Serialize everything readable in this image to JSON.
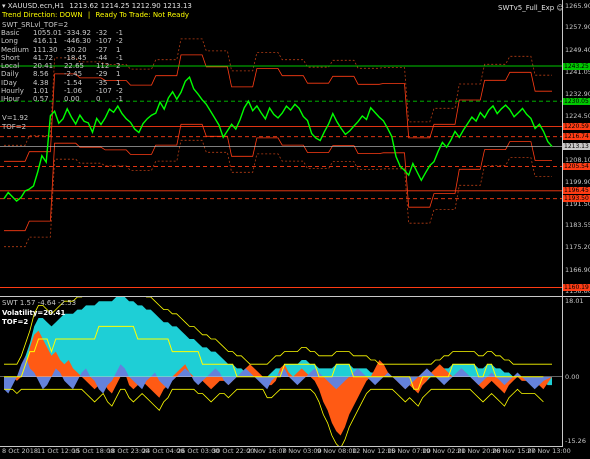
{
  "header": {
    "symbol": "XAUUSD.ecn,H1",
    "ohlc": "1213.62 1214.25 1212.90 1213.13",
    "trend_label": "Trend Direction:",
    "trend_value": "DOWN",
    "sep1": "|",
    "ready": "Ready To Trade:",
    "ready_value": "Not Ready",
    "expert": "SWTv5_Full_Exp",
    "expert_icon": "smiley-icon"
  },
  "panel": {
    "title": "SWT_SRLvl_TOF=2",
    "rows": [
      {
        "name": "Basic",
        "a": "1055.01",
        "b": "-334.92",
        "c": "-32",
        "d": "-1"
      },
      {
        "name": "Long",
        "a": "416.11",
        "b": "-446.30",
        "c": "-107",
        "d": "-2"
      },
      {
        "name": "Medium",
        "a": "111.30",
        "b": "-30.20",
        "c": "-27",
        "d": "1"
      },
      {
        "name": "Short",
        "a": "41.72",
        "b": "-18.45",
        "c": "-44",
        "d": "-1"
      },
      {
        "name": "Local",
        "a": "20.41",
        "b": "22.65",
        "c": "112",
        "d": "2"
      },
      {
        "name": "Daily",
        "a": "8.56",
        "b": "-2.45",
        "c": "-29",
        "d": "1"
      },
      {
        "name": "IDay",
        "a": "4.38",
        "b": "-1.54",
        "c": "-35",
        "d": "1"
      },
      {
        "name": "Hourly",
        "a": "1.01",
        "b": "-1.06",
        "c": "-107",
        "d": "-2"
      },
      {
        "name": "IHour",
        "a": "0.57",
        "b": "0.00",
        "c": "0",
        "d": "-1"
      }
    ],
    "v_line": "V=1.92",
    "tof_line": "TOF=2"
  },
  "sub": {
    "title": "SWT 1.57 -4.64 -2.53",
    "volatility": "Volatility=20.41",
    "tof": "TOF=2"
  },
  "colors": {
    "price": "#00ff00",
    "green_level": "#00c800",
    "red_level": "#ff3c14",
    "cyan": "#1ecfd6",
    "orange": "#ff5a14",
    "blue": "#6482dc",
    "yellow": "#ffff00"
  },
  "chart_data": [
    {
      "type": "line",
      "title": "",
      "y_ticks": [
        "1265.90",
        "1257.90",
        "1249.40",
        "1241.05",
        "1232.90",
        "1224.50",
        "1216.15",
        "1208.10",
        "1199.90",
        "1191.50",
        "1183.55",
        "1175.20",
        "1166.90",
        "1158.80"
      ],
      "ylim": [
        1157.0,
        1268.0
      ],
      "price": [
        1193.5,
        1195.8,
        1194.2,
        1192.6,
        1193.9,
        1196.4,
        1197.1,
        1198.3,
        1203.5,
        1209.6,
        1207.2,
        1224.6,
        1226.3,
        1221.8,
        1223.4,
        1227.2,
        1224.1,
        1221.5,
        1224.8,
        1222.5,
        1221.9,
        1218.4,
        1223.6,
        1221.3,
        1223.8,
        1227.1,
        1225.9,
        1228.2,
        1225.4,
        1223.5,
        1222.1,
        1219.6,
        1218.3,
        1221.7,
        1223.5,
        1224.8,
        1225.6,
        1229.7,
        1227.1,
        1231.3,
        1233.6,
        1230.8,
        1233.4,
        1237.5,
        1239.1,
        1234.7,
        1232.8,
        1230.6,
        1228.9,
        1226.3,
        1223.7,
        1221.1,
        1216.5,
        1218.9,
        1221.4,
        1219.6,
        1223.2,
        1227.6,
        1230.1,
        1226.5,
        1228.3,
        1225.7,
        1223.4,
        1227.5,
        1225.1,
        1223.8,
        1225.6,
        1228.2,
        1226.7,
        1228.9,
        1227.4,
        1224.3,
        1222.8,
        1217.9,
        1216.2,
        1215.3,
        1218.6,
        1221.5,
        1225.4,
        1222.3,
        1219.8,
        1217.6,
        1218.9,
        1220.7,
        1222.4,
        1224.5,
        1223.2,
        1227.6,
        1225.8,
        1224.1,
        1222.7,
        1219.9,
        1216.8,
        1209.3,
        1205.6,
        1204.1,
        1202.3,
        1206.7,
        1203.5,
        1200.4,
        1203.2,
        1205.9,
        1207.4,
        1211.3,
        1214.6,
        1212.8,
        1215.4,
        1218.7,
        1216.5,
        1219.3,
        1221.7,
        1224.1,
        1222.6,
        1225.8,
        1223.9,
        1226.7,
        1228.3,
        1225.4,
        1227.2,
        1228.6,
        1226.9,
        1224.2,
        1225.7,
        1227.3,
        1225.1,
        1223.6,
        1219.8,
        1221.4,
        1218.7,
        1214.9,
        1213.1
      ],
      "levels": [
        {
          "value": "1243.25",
          "color": "#00c800"
        },
        {
          "value": "1230.05",
          "color": "#00c800"
        },
        {
          "value": "1220.59",
          "color": "#ff3c14"
        },
        {
          "value": "1216.74",
          "color": "#ff3c14"
        },
        {
          "value": "1213.13",
          "color": "#c8c8c8"
        },
        {
          "value": "1205.54",
          "color": "#ff3c14"
        },
        {
          "value": "1196.45",
          "color": "#ff3c14"
        },
        {
          "value": "1193.50",
          "color": "#ff3c14"
        },
        {
          "value": "1160.19",
          "color": "#ff3c14"
        }
      ]
    },
    {
      "type": "area",
      "title": "",
      "y_ticks": [
        "18.01",
        "0.00",
        "-15.26"
      ],
      "ylim": [
        -16.5,
        19.0
      ],
      "cyan": [
        0,
        0,
        0,
        0,
        2,
        5,
        8,
        12,
        14,
        14,
        13,
        12,
        13,
        14,
        15,
        15,
        15,
        16,
        16,
        17,
        17,
        17,
        18,
        18,
        18,
        18,
        19,
        19,
        19,
        18,
        18,
        17,
        17,
        16,
        16,
        15,
        14,
        13,
        13,
        12,
        12,
        11,
        10,
        9,
        9,
        8,
        7,
        7,
        6,
        6,
        5,
        4,
        3,
        3,
        2,
        2,
        1,
        0,
        0,
        0,
        0,
        0,
        1,
        2,
        2,
        3,
        3,
        3,
        3,
        4,
        4,
        3,
        3,
        2,
        2,
        2,
        2,
        3,
        3,
        3,
        3,
        2,
        2,
        2,
        2,
        1,
        1,
        0,
        0,
        0,
        0,
        0,
        0,
        -1,
        -2,
        -3,
        -3,
        -2,
        -1,
        0,
        1,
        1,
        2,
        2,
        3,
        3,
        3,
        3,
        3,
        3,
        2,
        2,
        3,
        3,
        2,
        2,
        1,
        1,
        0,
        0,
        0,
        0,
        0,
        0,
        -1,
        -1,
        -2,
        -2
      ],
      "orange": [
        0,
        0,
        0,
        -1,
        0,
        2,
        7,
        10,
        11,
        9,
        7,
        5,
        6,
        4,
        3,
        4,
        2,
        1,
        0,
        -1,
        -2,
        -3,
        -2,
        -1,
        -3,
        -4,
        -2,
        0,
        1,
        -2,
        -3,
        -2,
        -1,
        -2,
        -3,
        -4,
        -5,
        -3,
        -2,
        0,
        1,
        2,
        3,
        1,
        0,
        -1,
        -1,
        -2,
        -3,
        -2,
        -1,
        -1,
        -2,
        -1,
        0,
        1,
        2,
        3,
        2,
        1,
        0,
        -2,
        -2,
        -1,
        2,
        3,
        1,
        0,
        1,
        2,
        1,
        0,
        -1,
        -3,
        -6,
        -8,
        -11,
        -13,
        -14,
        -12,
        -9,
        -7,
        -5,
        -3,
        -1,
        0,
        2,
        4,
        3,
        1,
        0,
        -1,
        -2,
        -3,
        -2,
        -3,
        -4,
        -2,
        -1,
        1,
        2,
        3,
        2,
        1,
        0,
        1,
        2,
        1,
        0,
        -1,
        -2,
        -3,
        -2,
        -1,
        -2,
        -3,
        -4,
        -2,
        -1,
        0,
        -1,
        -1,
        -1,
        -1,
        -2,
        -3
      ],
      "blue": [
        -3,
        -4,
        -2,
        0,
        3,
        5,
        2,
        1,
        -1,
        -3,
        -2,
        0,
        2,
        1,
        -1,
        -2,
        -3,
        -1,
        1,
        2,
        0,
        -1,
        -3,
        -4,
        -2,
        -1,
        1,
        3,
        2,
        0,
        -1,
        -2,
        -3,
        -1,
        0,
        1,
        -1,
        -2,
        -3,
        -1,
        0,
        1,
        2,
        1,
        -1,
        -2,
        -1,
        0,
        1,
        2,
        1,
        -1,
        -2,
        -1,
        0,
        1,
        2,
        1,
        0,
        -1,
        -2,
        -3,
        -1,
        0,
        1,
        2,
        0,
        -1,
        -2,
        -1,
        0,
        1,
        2,
        1,
        0,
        -1,
        -2,
        -3,
        -2,
        -1,
        0,
        1,
        2,
        1,
        0,
        -1,
        -2,
        -1,
        0,
        1,
        0,
        -1,
        -2,
        -3,
        -2,
        -1,
        0,
        1,
        2,
        1,
        0,
        -1,
        -2,
        -1,
        0,
        1,
        2,
        1,
        0,
        -1,
        -2,
        -1,
        0,
        1,
        0,
        -1,
        -2,
        -1,
        0,
        1,
        0,
        -1,
        -2,
        -3,
        -2,
        -1
      ]
    }
  ],
  "x_labels": [
    "8 Oct 2018",
    "11 Oct 12:00",
    "15 Oct 18:00",
    "18 Oct 23:00",
    "24 Oct 04:00",
    "26 Oct 03:00",
    "30 Oct 22:00",
    "2 Nov 16:00",
    "7 Nov 03:00",
    "9 Nov 08:00",
    "12 Nov 12:00",
    "15 Nov 07:00",
    "19 Nov 02:00",
    "21 Nov 20:00",
    "26 Nov 15:00",
    "27 Nov 13:00"
  ]
}
